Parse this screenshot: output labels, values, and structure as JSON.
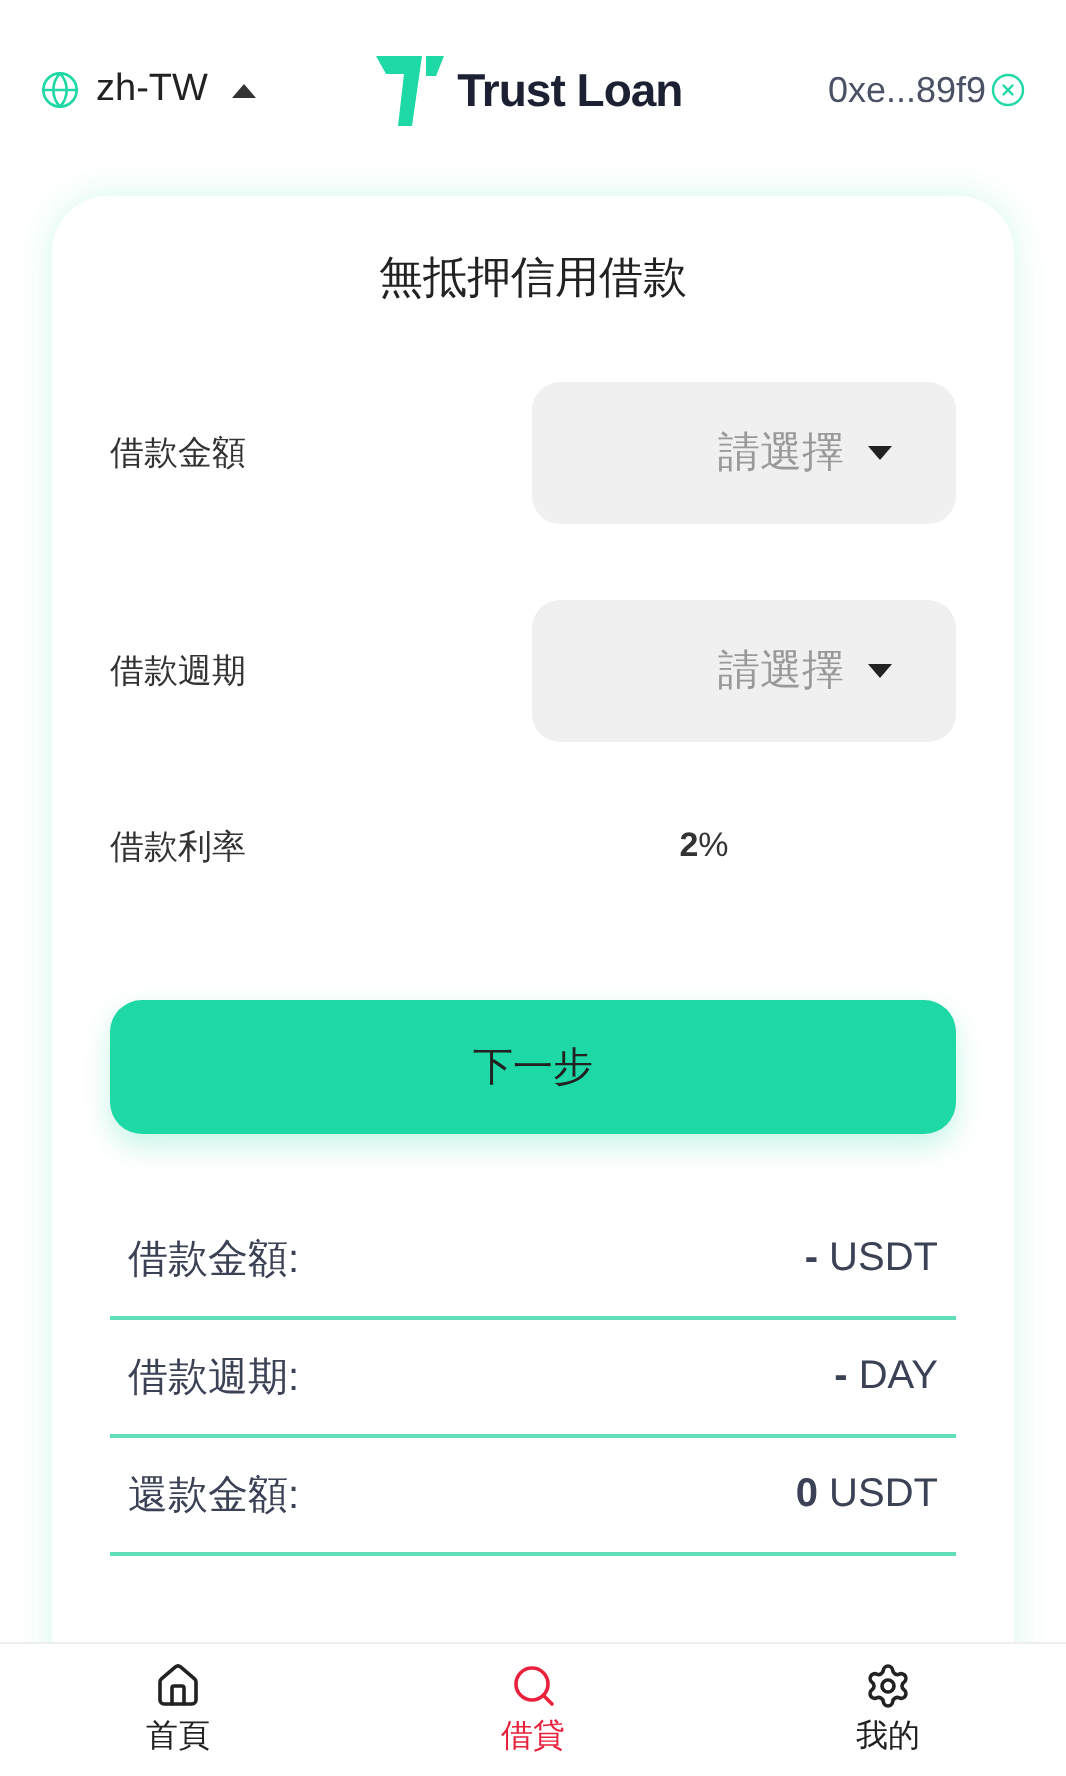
{
  "header": {
    "language": "zh-TW",
    "brand": "Trust Loan",
    "wallet": "0xe...89f9"
  },
  "card": {
    "title": "無抵押信用借款",
    "fields": [
      {
        "kind": "select",
        "label": "借款金額",
        "placeholder": "請選擇"
      },
      {
        "kind": "select",
        "label": "借款週期",
        "placeholder": "請選擇"
      },
      {
        "kind": "value",
        "label": "借款利率",
        "value": "**2**%"
      }
    ],
    "button": "下一步",
    "summary": [
      {
        "label": "借款金額:",
        "value": "**-** USDT"
      },
      {
        "label": "借款週期:",
        "value": "**-** DAY"
      },
      {
        "label": "還款金額:",
        "value": "**0** USDT"
      }
    ]
  },
  "nav": [
    {
      "kind": "home",
      "label": "首頁",
      "selected": false
    },
    {
      "kind": "search",
      "label": "借貸",
      "selected": true
    },
    {
      "kind": "settings",
      "label": "我的",
      "selected": false
    }
  ]
}
